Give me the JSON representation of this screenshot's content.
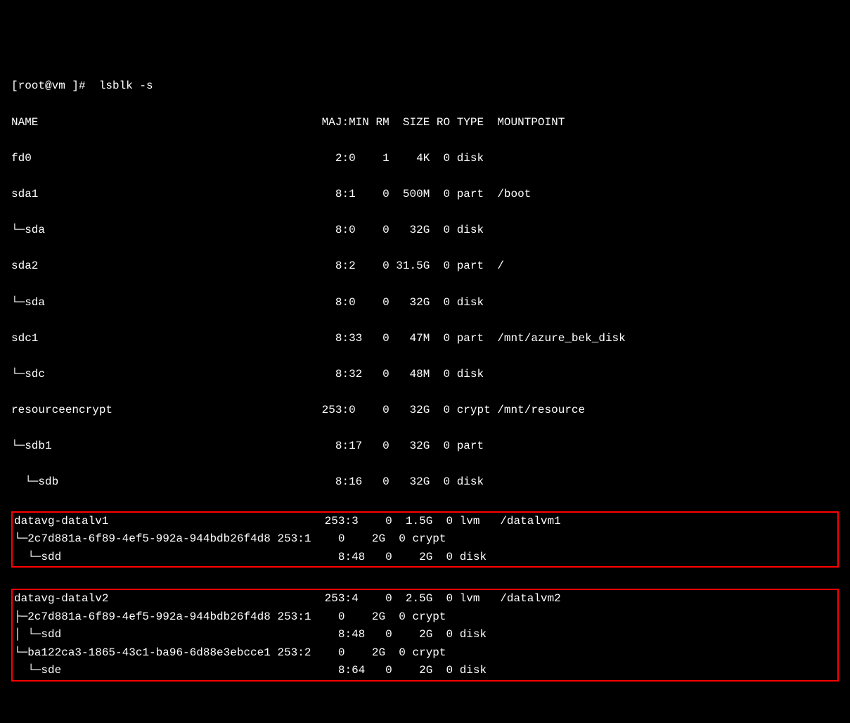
{
  "prompt": "[root@vm ]#  lsblk -s",
  "header": "NAME                                          MAJ:MIN RM  SIZE RO TYPE  MOUNTPOINT",
  "rows": {
    "r0": "fd0                                             2:0    1    4K  0 disk",
    "r1": "sda1                                            8:1    0  500M  0 part  /boot",
    "r2": "└─sda                                           8:0    0   32G  0 disk",
    "r3": "sda2                                            8:2    0 31.5G  0 part  /",
    "r4": "└─sda                                           8:0    0   32G  0 disk",
    "r5": "sdc1                                            8:33   0   47M  0 part  /mnt/azure_bek_disk",
    "r6": "└─sdc                                           8:32   0   48M  0 disk",
    "r7": "resourceencrypt                               253:0    0   32G  0 crypt /mnt/resource",
    "r8": "└─sdb1                                          8:17   0   32G  0 part",
    "r9": "  └─sdb                                         8:16   0   32G  0 disk"
  },
  "box1": {
    "r0": "datavg-datalv1                                253:3    0  1.5G  0 lvm   /datalvm1",
    "r1": "└─2c7d881a-6f89-4ef5-992a-944bdb26f4d8 253:1    0    2G  0 crypt",
    "r2": "  └─sdd                                         8:48   0    2G  0 disk"
  },
  "box2": {
    "r0": "datavg-datalv2                                253:4    0  2.5G  0 lvm   /datalvm2",
    "r1": "├─2c7d881a-6f89-4ef5-992a-944bdb26f4d8 253:1    0    2G  0 crypt",
    "r2": "│ └─sdd                                         8:48   0    2G  0 disk",
    "r3": "└─ba122ca3-1865-43c1-ba96-6d88e3ebcce1 253:2    0    2G  0 crypt",
    "r4": "  └─sde                                         8:64   0    2G  0 disk"
  }
}
